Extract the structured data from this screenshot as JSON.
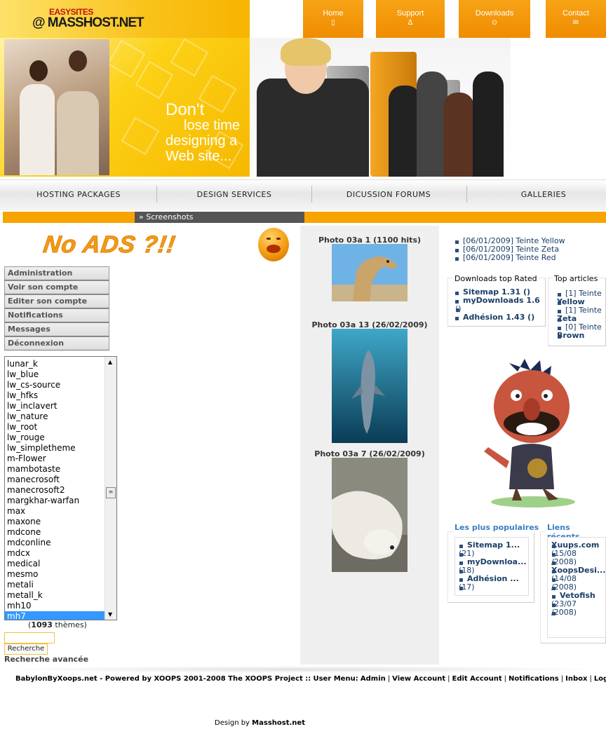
{
  "header": {
    "logo_top": "EASYSITES",
    "logo_main": "@ MASSHOST.NET",
    "topnav": [
      {
        "label": "Home",
        "icon": "home-icon"
      },
      {
        "label": "Support",
        "icon": "lamp-icon"
      },
      {
        "label": "Downloads",
        "icon": "download-icon"
      },
      {
        "label": "Contact",
        "icon": "mail-icon"
      }
    ]
  },
  "banner": {
    "line1": "Don't",
    "line2": "lose time",
    "line3": "designing a",
    "line4": "Web site..."
  },
  "mainnav": [
    "HOSTING PACKAGES",
    "DESIGN SERVICES",
    "DICUSSION FORUMS",
    "GALLERIES"
  ],
  "breadcrumb": "Screenshots",
  "noads": "No ADS ?!!",
  "usermenu": [
    "Administration",
    "Voir son compte",
    "Editer son compte",
    "Notifications",
    "Messages",
    "Déconnexion"
  ],
  "themes": {
    "options": [
      "lunar_k",
      "lw_blue",
      "lw_cs-source",
      "lw_hfks",
      "lw_inclavert",
      "lw_nature",
      "lw_root",
      "lw_rouge",
      "lw_simpletheme",
      "m-Flower",
      "mambotaste",
      "manecrosoft",
      "manecrosoft2",
      "margkhar-warfan",
      "max",
      "maxone",
      "mdcone",
      "mdconline",
      "mdcx",
      "medical",
      "mesmo",
      "metali",
      "metall_k",
      "mh10",
      "mh7"
    ],
    "selected": "mh7",
    "count_prefix": "(",
    "count": "1093",
    "count_suffix": " thèmes)"
  },
  "search": {
    "button": "Recherche",
    "advanced": "Recherche avancée"
  },
  "photos": [
    {
      "title": "Photo 03a 1 (1100 hits)"
    },
    {
      "title": "Photo 03a 13 (26/02/2009)"
    },
    {
      "title": "Photo 03a 7 (26/02/2009)"
    }
  ],
  "recent_news": [
    "[06/01/2009] Teinte Yellow",
    "[06/01/2009] Teinte Zeta",
    "[06/01/2009] Teinte Red"
  ],
  "downloads_top": {
    "title": "Downloads top Rated",
    "items": [
      {
        "line1": "Sitemap 1.31 ()"
      },
      {
        "line1": "myDownloads 1.6",
        "line2": "()"
      },
      {
        "line1": "Adhésion 1.43 ()"
      }
    ]
  },
  "top_articles": {
    "title": "Top articles",
    "items": [
      {
        "line1": "[1] Teinte",
        "line2": "Yellow"
      },
      {
        "line1": "[1] Teinte",
        "line2": "Zeta"
      },
      {
        "line1": "[0] Teinte",
        "line2": "Brown"
      }
    ]
  },
  "popular": {
    "title": "Les plus populaires",
    "items": [
      {
        "name": "Sitemap 1...",
        "count": "(21)"
      },
      {
        "name": "myDownloa...",
        "count": "(18)"
      },
      {
        "name": "Adhésion ...",
        "count": "(17)"
      }
    ]
  },
  "recent_links": {
    "title": "Liens récents",
    "items": [
      {
        "name": "Xuups.com",
        "date1": "(15/08",
        "date2": "/2008)"
      },
      {
        "name": "XoopsDesi...",
        "date1": "(14/08",
        "date2": "/2008)"
      },
      {
        "name": "Vetofish",
        "date1": "(23/07",
        "date2": "/2008)"
      }
    ]
  },
  "footer": {
    "powered": "BabylonByXoops.net - Powered by XOOPS 2001-2008 The XOOPS Project ::",
    "usermenu_label": "User Menu:",
    "links": [
      "Admin",
      "View Account",
      "Edit Account",
      "Notifications",
      "Inbox",
      "Logout"
    ],
    "design_prefix": "Design by",
    "design_by": "Masshost.net"
  }
}
